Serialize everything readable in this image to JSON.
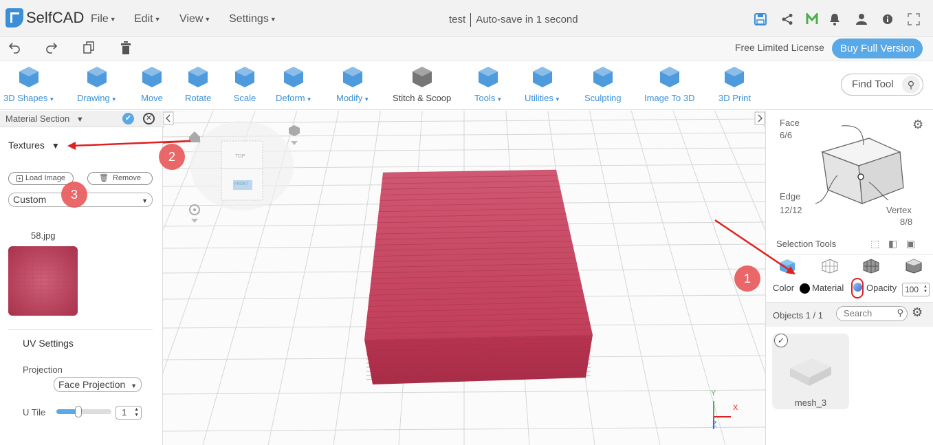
{
  "app": {
    "name": "SelfCAD"
  },
  "menus": [
    {
      "label": "File"
    },
    {
      "label": "Edit"
    },
    {
      "label": "View"
    },
    {
      "label": "Settings"
    }
  ],
  "document": {
    "title": "test",
    "autosave": "Auto-save in 1 second"
  },
  "secondary": {
    "license": "Free Limited License",
    "buy": "Buy Full Version"
  },
  "tools": [
    {
      "label": "3D Shapes",
      "dropdown": true
    },
    {
      "label": "Drawing",
      "dropdown": true
    },
    {
      "label": "Move"
    },
    {
      "label": "Rotate"
    },
    {
      "label": "Scale"
    },
    {
      "label": "Deform",
      "dropdown": true
    },
    {
      "label": "Modify",
      "dropdown": true
    },
    {
      "label": "Stitch & Scoop"
    },
    {
      "label": "Tools",
      "dropdown": true
    },
    {
      "label": "Utilities",
      "dropdown": true
    },
    {
      "label": "Sculpting"
    },
    {
      "label": "Image To 3D"
    },
    {
      "label": "3D Print"
    }
  ],
  "find_tool": {
    "label": "Find Tool"
  },
  "material_panel": {
    "title": "Material Section",
    "textures_label": "Textures",
    "load_image": "Load Image",
    "remove": "Remove",
    "texture_type": "Custom",
    "image_name": "58.jpg",
    "uv_title": "UV Settings",
    "projection_label": "Projection",
    "projection_value": "Face Projection",
    "utile_label": "U Tile",
    "utile_value": "1",
    "utile_slider": 0.4
  },
  "viewcube": {
    "top": "TOP",
    "front": "FRONT"
  },
  "axes": {
    "y": "Y",
    "x": "X",
    "z": "Z"
  },
  "selection": {
    "face_label": "Face",
    "face_count": "6/6",
    "edge_label": "Edge",
    "edge_count": "12/12",
    "vertex_label": "Vertex",
    "vertex_count": "8/8",
    "tools_label": "Selection Tools"
  },
  "properties": {
    "color_label": "Color",
    "material_label": "Material",
    "opacity_label": "Opacity",
    "opacity_value": "100"
  },
  "objects": {
    "label": "Objects 1 / 1",
    "search_placeholder": "Search",
    "item_name": "mesh_3"
  },
  "annotations": [
    "1",
    "2",
    "3"
  ],
  "colors": {
    "accent": "#3a8fd8",
    "brick": "#c23a55",
    "annotation": "#e8585a",
    "arrow": "#e02020"
  }
}
